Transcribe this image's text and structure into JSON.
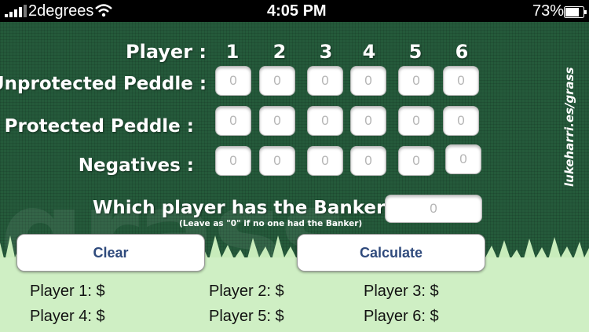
{
  "status": {
    "carrier": "2degrees",
    "time": "4:05 PM",
    "battery": "73%"
  },
  "app": {
    "watermark": "grass",
    "side_url": "lukeharri.es/grass",
    "player_label": "Player :",
    "players": [
      "1",
      "2",
      "3",
      "4",
      "5",
      "6"
    ],
    "rows": [
      {
        "label": "Unprotected Peddle :",
        "values": [
          "0",
          "0",
          "0",
          "0",
          "0",
          "0"
        ]
      },
      {
        "label": "Protected Peddle :",
        "values": [
          "0",
          "0",
          "0",
          "0",
          "0",
          "0"
        ]
      },
      {
        "label": "Negatives :",
        "values": [
          "0",
          "0",
          "0",
          "0",
          "0",
          "0"
        ]
      }
    ],
    "banker": {
      "question": "Which player has the Banker?",
      "hint": "(Leave as \"0\" if no one had the Banker)",
      "value": "0"
    },
    "buttons": {
      "clear": "Clear",
      "calculate": "Calculate"
    },
    "results": [
      "Player 1: $",
      "Player 2: $",
      "Player 3: $",
      "Player 4: $",
      "Player 5: $",
      "Player 6: $"
    ]
  }
}
